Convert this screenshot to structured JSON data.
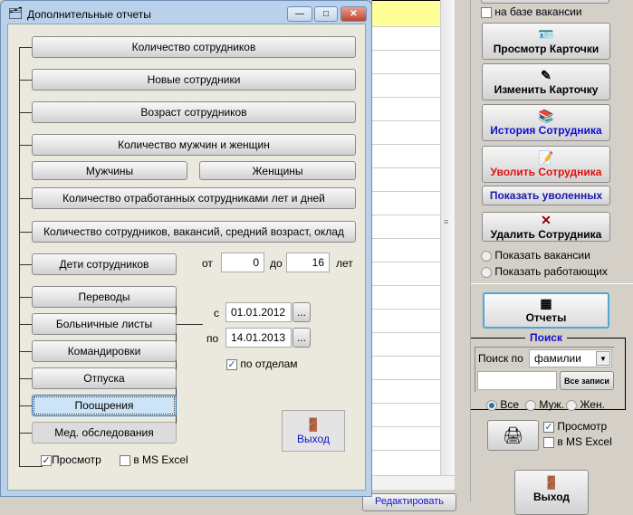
{
  "window": {
    "title": "Дополнительные отчеты",
    "buttons": {
      "minimize": "—",
      "maximize": "□",
      "close": "✕"
    }
  },
  "reports": {
    "count_employees": "Количество сотрудников",
    "new_employees": "Новые сотрудники",
    "age_employees": "Возраст сотрудников",
    "men_women": "Количество мужчин и женщин",
    "men": "Мужчины",
    "women": "Женщины",
    "years_days": "Количество отработанных сотрудниками лет и дней",
    "summary": "Количество сотрудников, вакансий, средний возраст, оклад",
    "children": "Дети сотрудников",
    "transfers": "Переводы",
    "sick_leave": "Больничные листы",
    "trips": "Командировки",
    "vacations": "Отпуска",
    "rewards": "Поощрения",
    "medical": "Мед. обследования"
  },
  "age_range": {
    "from_label": "от",
    "from_value": "0",
    "to_label": "до",
    "to_value": "16",
    "unit": "лет"
  },
  "period": {
    "from_label": "с",
    "from_value": "01.01.2012",
    "to_label": "по",
    "to_value": "14.01.2013",
    "picker": "...",
    "by_dept_label": "по отделам",
    "by_dept_checked": true
  },
  "options": {
    "preview_label": "Просмотр",
    "preview_checked": true,
    "excel_label": "в MS Excel",
    "excel_checked": false
  },
  "exit_label": "Выход",
  "right_panel": {
    "vacancy_base": "на базе вакансии",
    "view_card": "Просмотр Карточки",
    "edit_card": "Изменить Карточку",
    "history": "История Сотрудника",
    "dismiss": "Уволить Сотрудника",
    "show_dismissed": "Показать уволенных",
    "delete": "Удалить Сотрудника",
    "show_vacancies": "Показать вакансии",
    "show_working": "Показать работающих",
    "reports": "Отчеты",
    "search_title": "Поиск",
    "search_by": "Поиск по",
    "search_field": "фамилии",
    "search_value": "",
    "all_records": "Все записи",
    "gender_all": "Все",
    "gender_male": "Муж.",
    "gender_female": "Жен.",
    "preview": "Просмотр",
    "excel": "в MS Excel",
    "exit": "Выход"
  },
  "bottom_button": "Редактировать",
  "colors": {
    "history": "#1010d0",
    "dismiss": "#e01010",
    "show_dismissed": "#1a1ab0",
    "search_title": "#1010d0",
    "grid_highlight": "#ffff99"
  }
}
